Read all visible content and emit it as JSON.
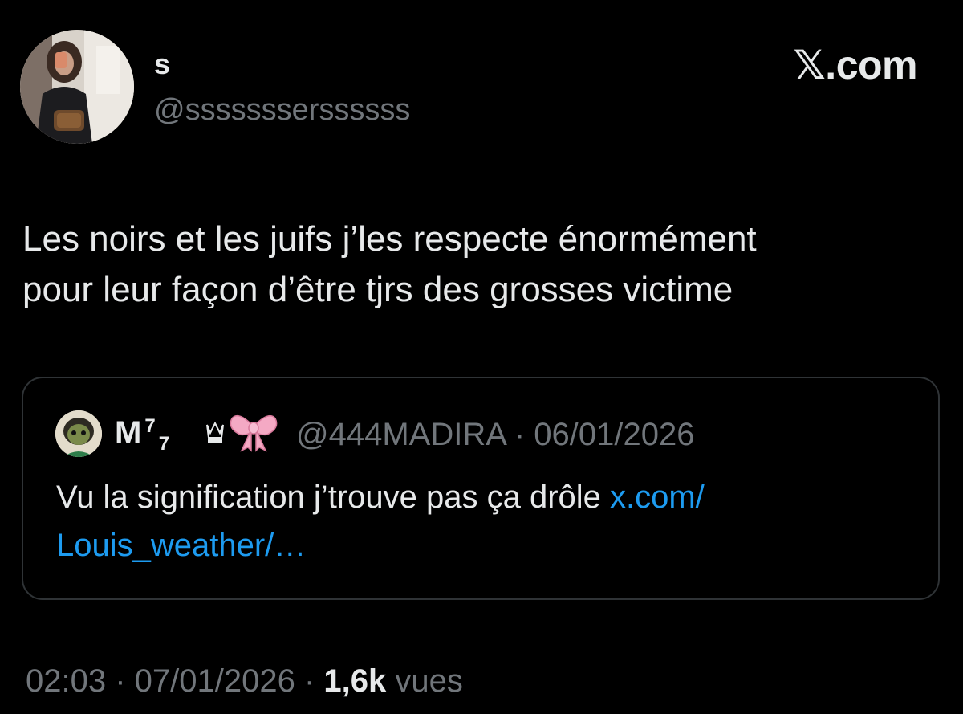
{
  "tweet": {
    "display_name": "s",
    "handle": "@ssssssserssssss",
    "brand": "𝕏.com",
    "text": "Les noirs et les juifs j’les respecte énormément\npour leur façon d’être tjrs des grosses victime",
    "avatar_icon": "profile-photo",
    "colors": {
      "background": "#000000",
      "primary_text": "#e7e9ea",
      "secondary_text": "#71767b",
      "link": "#1d9bf0",
      "card_border": "#2f3336"
    }
  },
  "quote": {
    "name": "M",
    "name_sup": "7",
    "name_sub": "7",
    "crown_glyph": "♕",
    "bow_icon": "pink-ribbon-bow",
    "meta": "@444MADIRA · 06/01/2026",
    "text_before_link": "Vu la signification j’trouve pas ça drôle ",
    "link_line1": "x.com/",
    "link_line2": "Louis_weather/…"
  },
  "footer": {
    "time_date": "02:03 · 07/01/2026 · ",
    "views_count": "1,6k",
    "views_label": " vues"
  }
}
